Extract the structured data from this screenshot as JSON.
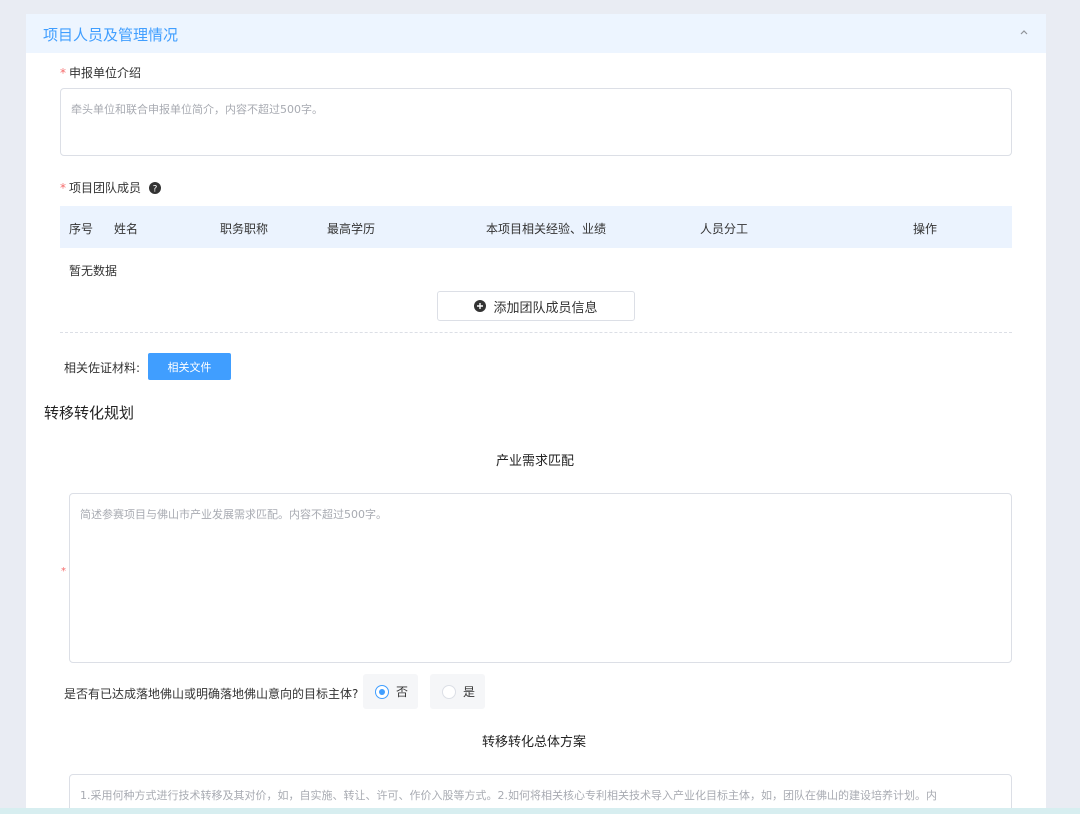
{
  "section1": {
    "title": "项目人员及管理情况",
    "intro_label": "申报单位介绍",
    "intro_placeholder": "牵头单位和联合申报单位简介，内容不超过500字。",
    "team_label": "项目团队成员",
    "table_headers": [
      "序号",
      "姓名",
      "职务职称",
      "最高学历",
      "本项目相关经验、业绩",
      "人员分工",
      "操作"
    ],
    "empty_text": "暂无数据",
    "add_button": "添加团队成员信息",
    "evidence_label": "相关佐证材料:",
    "evidence_button": "相关文件"
  },
  "section2": {
    "title": "转移转化规划",
    "industry_title": "产业需求匹配",
    "industry_placeholder": "简述参赛项目与佛山市产业发展需求匹配。内容不超过500字。",
    "question": "是否有已达成落地佛山或明确落地佛山意向的目标主体?",
    "options": [
      {
        "label": "否",
        "checked": true
      },
      {
        "label": "是",
        "checked": false
      }
    ],
    "plan_title": "转移转化总体方案",
    "plan_placeholder": "1.采用何种方式进行技术转移及其对价，如，自实施、转让、许可、作价入股等方式。2.如何将相关核心专利相关技术导入产业化目标主体，如，团队在佛山的建设培养计划。内"
  },
  "required_mark": "*",
  "colors": {
    "accent": "#409eff",
    "required": "#f56c6c",
    "header_bg": "#edf5ff"
  },
  "icons": {
    "collapse": "chevron-up-icon",
    "help": "question-circle-icon",
    "add": "plus-circle-icon"
  }
}
